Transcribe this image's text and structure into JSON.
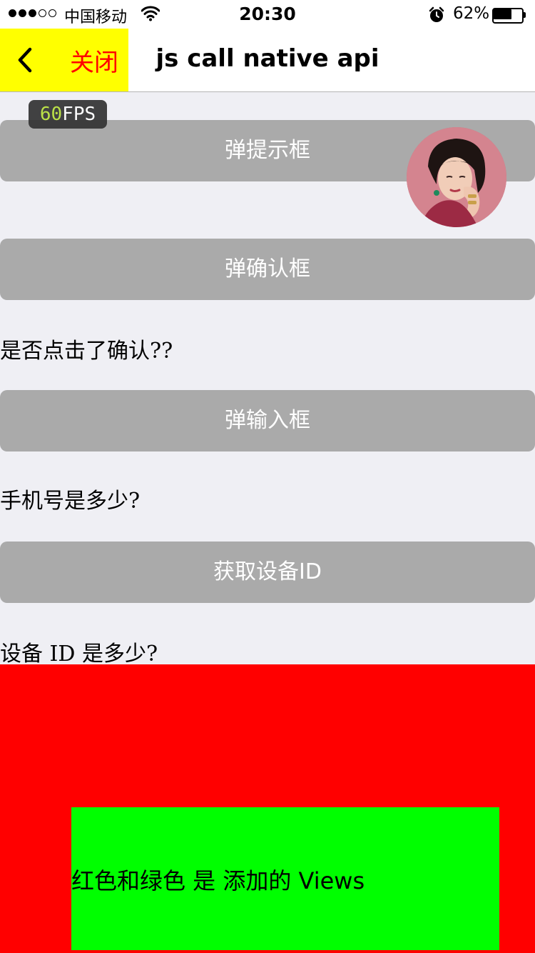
{
  "status_bar": {
    "carrier": "中国移动",
    "time": "20:30",
    "battery_percent": "62%",
    "battery_level": 0.62,
    "signal_bars_filled": 3,
    "signal_bars_total": 5
  },
  "nav": {
    "close_label": "关闭",
    "title": "js call native api",
    "back_icon": "chevron-left-icon"
  },
  "fps": {
    "value": "60",
    "unit": "FPS"
  },
  "buttons": {
    "alert": "弹提示框",
    "confirm": "弹确认框",
    "prompt": "弹输入框",
    "device_id": "获取设备ID"
  },
  "results": {
    "confirm_result": "是否点击了确认??",
    "phone_result": "手机号是多少?",
    "device_result": "设备 ID 是多少?"
  },
  "views": {
    "green_label": "红色和绿色 是 添加的 Views",
    "red_color": "#ff0000",
    "green_color": "#00ff00"
  },
  "colors": {
    "nav_left_bg": "#ffff00",
    "close_text": "#ff0000",
    "button_bg": "#aaaaaa",
    "page_bg": "#efeff4"
  }
}
